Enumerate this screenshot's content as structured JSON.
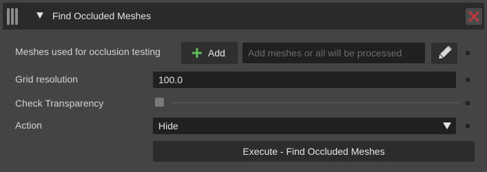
{
  "header": {
    "title": "Find Occluded Meshes",
    "grip_icon": "drag-handle-icon",
    "collapse_icon": "triangle-down-icon",
    "close_icon": "close-x-icon",
    "close_color": "#c0393b"
  },
  "fields": {
    "meshes": {
      "label": "Meshes used for occlusion testing",
      "add_label": "Add",
      "add_icon": "plus-icon",
      "add_icon_color": "#5fbf5f",
      "placeholder": "Add meshes or all will be processed",
      "edit_icon": "pencil-icon"
    },
    "grid_resolution": {
      "label": "Grid resolution",
      "value": "100.0"
    },
    "check_transparency": {
      "label": "Check Transparency",
      "checked": false
    },
    "action": {
      "label": "Action",
      "selected": "Hide"
    }
  },
  "execute": {
    "label": "Execute - Find Occluded Meshes"
  }
}
